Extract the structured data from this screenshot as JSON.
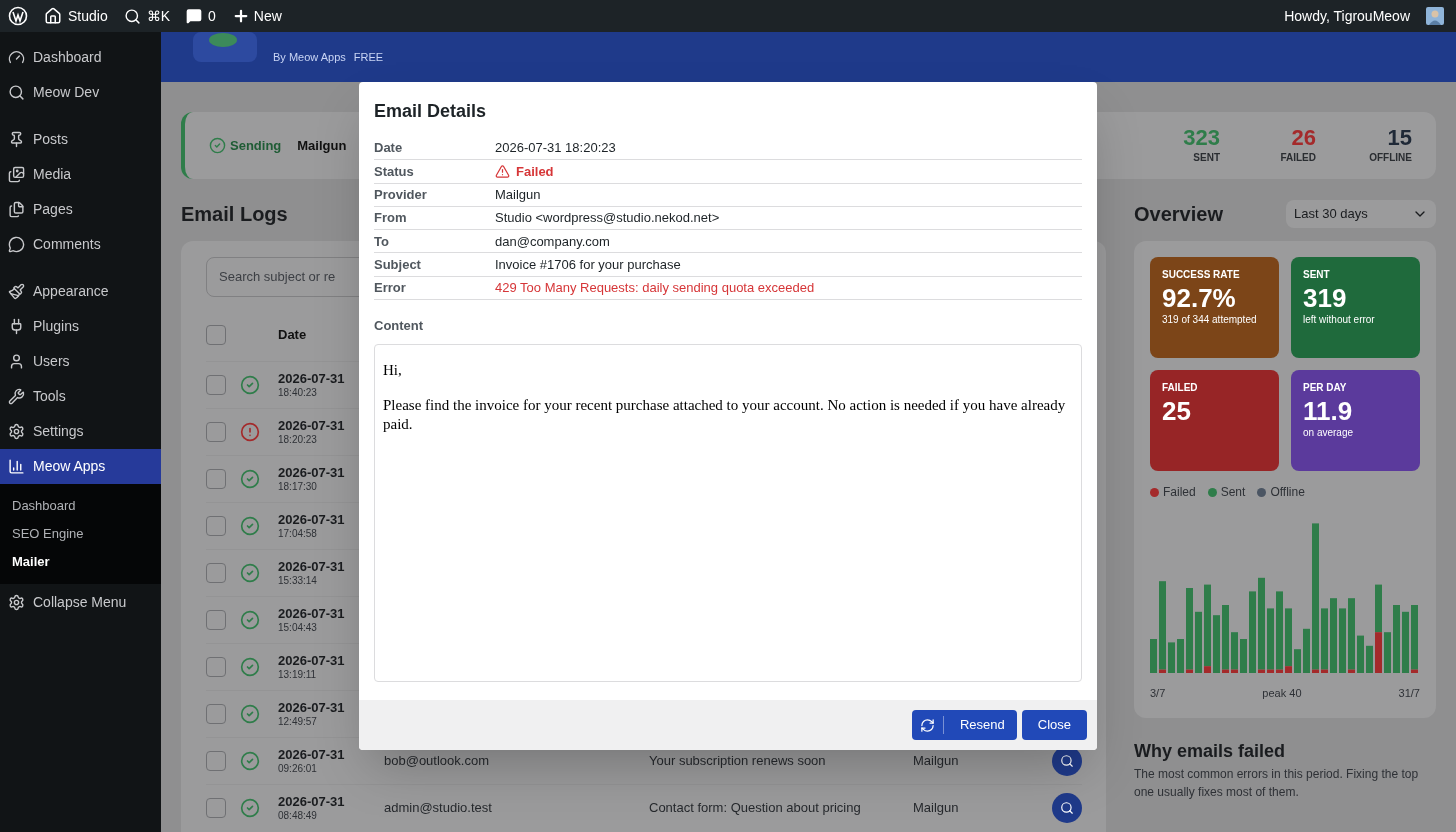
{
  "topbar": {
    "site": "Studio",
    "shortcut": "⌘K",
    "comments": "0",
    "new": "New",
    "greeting": "Howdy, TigrouMeow"
  },
  "sidebar": {
    "groups": [
      [
        {
          "label": "Dashboard",
          "selected": false
        },
        {
          "label": "Meow Dev",
          "selected": false
        }
      ],
      [
        {
          "label": "Posts",
          "selected": false
        },
        {
          "label": "Media",
          "selected": false
        },
        {
          "label": "Pages",
          "selected": false
        },
        {
          "label": "Comments",
          "selected": false
        }
      ],
      [
        {
          "label": "Appearance",
          "selected": false
        },
        {
          "label": "Plugins",
          "selected": false
        },
        {
          "label": "Users",
          "selected": false
        },
        {
          "label": "Tools",
          "selected": false
        },
        {
          "label": "Settings",
          "selected": false
        },
        {
          "label": "Meow Apps",
          "selected": true
        }
      ]
    ],
    "submenu": [
      {
        "label": "Dashboard",
        "selected": false
      },
      {
        "label": "SEO Engine",
        "selected": false
      },
      {
        "label": "Mailer",
        "selected": true
      }
    ],
    "collapse": "Collapse Menu"
  },
  "header": {
    "byline": "By Meow Apps",
    "badge": "FREE"
  },
  "status_card": {
    "state": "Sending",
    "provider": "Mailgun",
    "stats": [
      {
        "value": "323",
        "label": "SENT",
        "color": "#2f7d4a"
      },
      {
        "value": "26",
        "label": "FAILED",
        "color": "#a42a2b"
      },
      {
        "value": "15",
        "label": "OFFLINE",
        "color": "#1f2937"
      }
    ]
  },
  "email_logs": {
    "title": "Email Logs",
    "search_placeholder": "Search subject or re",
    "column": "Date",
    "select_all_checked": false,
    "rows": [
      {
        "date": "2026-07-31",
        "time": "18:40:23",
        "failed": false,
        "checked": false
      },
      {
        "date": "2026-07-31",
        "time": "18:20:23",
        "failed": true,
        "checked": false
      },
      {
        "date": "2026-07-31",
        "time": "18:17:30",
        "failed": false,
        "checked": false
      },
      {
        "date": "2026-07-31",
        "time": "17:04:58",
        "failed": false,
        "checked": false
      },
      {
        "date": "2026-07-31",
        "time": "15:33:14",
        "failed": false,
        "checked": false
      },
      {
        "date": "2026-07-31",
        "time": "15:04:43",
        "failed": false,
        "checked": false
      },
      {
        "date": "2026-07-31",
        "time": "13:19:11",
        "failed": false,
        "checked": false
      },
      {
        "date": "2026-07-31",
        "time": "12:49:57",
        "failed": false,
        "checked": false
      },
      {
        "date": "2026-07-31",
        "time": "09:26:01",
        "failed": false,
        "checked": false,
        "to": "bob@outlook.com",
        "subject": "Your subscription renews soon",
        "provider": "Mailgun"
      },
      {
        "date": "2026-07-31",
        "time": "08:48:49",
        "failed": false,
        "checked": false,
        "to": "admin@studio.test",
        "subject": "Contact form: Question about pricing",
        "provider": "Mailgun"
      }
    ]
  },
  "overview": {
    "title": "Overview",
    "range": "Last 30 days",
    "tiles": [
      {
        "label": "SUCCESS RATE",
        "value": "92.7%",
        "note": "319 of 344 attempted",
        "color": "#7c4518"
      },
      {
        "label": "SENT",
        "value": "319",
        "note": "left without error",
        "color": "#1f6a3c"
      },
      {
        "label": "FAILED",
        "value": "25",
        "color": "#972526"
      },
      {
        "label": "PER DAY",
        "value": "11.9",
        "note": "on average",
        "color": "#5b3a9c"
      }
    ],
    "legend": [
      {
        "label": "Failed",
        "color": "#a42a2b"
      },
      {
        "label": "Sent",
        "color": "#2f7d4a"
      },
      {
        "label": "Offline",
        "color": "#4b5563"
      }
    ],
    "axis": [
      "3/7",
      "peak 40",
      "31/7"
    ]
  },
  "failures": {
    "title": "Why emails failed",
    "description": "The most common errors in this period. Fixing the top one usually fixes most of them."
  },
  "dialog": {
    "title": "Email Details",
    "fields": [
      {
        "label": "Date",
        "value": "2026-07-31 18:20:23",
        "kind": "text"
      },
      {
        "label": "Status",
        "value": "Failed",
        "kind": "status"
      },
      {
        "label": "Provider",
        "value": "Mailgun",
        "kind": "text"
      },
      {
        "label": "From",
        "value": "Studio <wordpress@studio.nekod.net>",
        "kind": "text"
      },
      {
        "label": "To",
        "value": "dan@company.com",
        "kind": "text"
      },
      {
        "label": "Subject",
        "value": "Invoice #1706 for your purchase",
        "kind": "text"
      },
      {
        "label": "Error",
        "value": "429 Too Many Requests: daily sending quota exceeded",
        "kind": "error"
      }
    ],
    "content_label": "Content",
    "content": [
      "Hi,",
      "Please find the invoice for your recent purchase attached to your account. No action is needed if you have already paid."
    ],
    "buttons": [
      {
        "label": "Resend",
        "kind": "resend"
      },
      {
        "label": "Close",
        "kind": "close"
      }
    ]
  }
}
